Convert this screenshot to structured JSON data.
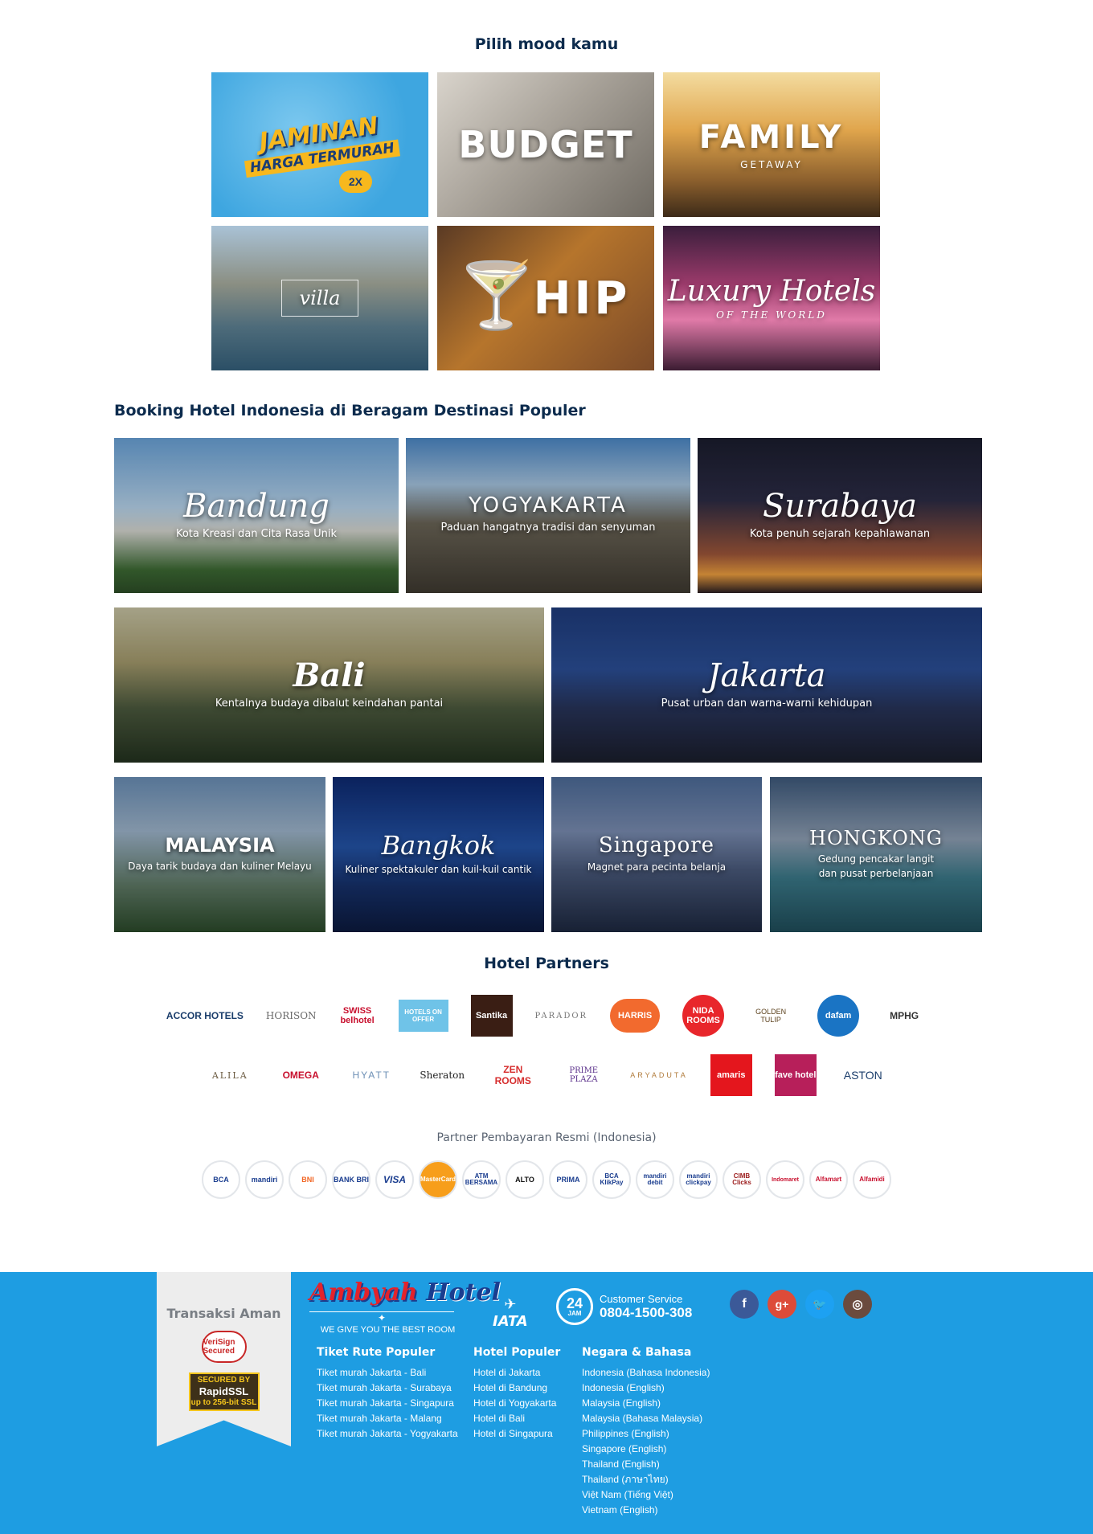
{
  "mood": {
    "title": "Pilih mood kamu",
    "cards": [
      {
        "label": "JAMINAN",
        "sub": "HARGA TERMURAH",
        "badge": "2X"
      },
      {
        "label": "BUDGET",
        "sub": ""
      },
      {
        "label": "FAMILY",
        "sub": "GETAWAY"
      },
      {
        "label": "villa",
        "sub": ""
      },
      {
        "label": "HIP",
        "sub": ""
      },
      {
        "label": "Luxury Hotels",
        "sub": "OF THE WORLD"
      }
    ]
  },
  "destinations": {
    "title": "Booking Hotel Indonesia di Beragam Destinasi Populer",
    "items": [
      {
        "name": "Bandung",
        "tagline": "Kota Kreasi dan Cita Rasa Unik"
      },
      {
        "name": "YOGYAKARTA",
        "tagline": "Paduan hangatnya tradisi dan senyuman"
      },
      {
        "name": "Surabaya",
        "tagline": "Kota penuh sejarah kepahlawanan"
      },
      {
        "name": "Bali",
        "tagline": "Kentalnya budaya dibalut keindahan pantai"
      },
      {
        "name": "Jakarta",
        "tagline": "Pusat urban dan warna-warni kehidupan"
      },
      {
        "name": "MALAYSIA",
        "tagline": "Daya tarik budaya dan kuliner Melayu"
      },
      {
        "name": "Bangkok",
        "tagline": "Kuliner spektakuler dan kuil-kuil cantik"
      },
      {
        "name": "Singapore",
        "tagline": "Magnet para pecinta belanja"
      },
      {
        "name": "HONGKONG",
        "tagline": "Gedung pencakar langit dan pusat perbelanjaan"
      }
    ]
  },
  "partners": {
    "title": "Hotel Partners",
    "row1": [
      "ACCOR HOTELS",
      "HORISON",
      "SWISS belhotel",
      "HOTELS ON OFFER",
      "Santika",
      "PARADOR",
      "HARRIS",
      "NIDA ROOMS",
      "GOLDEN TULIP",
      "dafam",
      "MPHG"
    ],
    "row2": [
      "ALILA",
      "OMEGA",
      "HYATT",
      "Sheraton",
      "ZEN ROOMS",
      "PRIME PLAZA",
      "ARYADUTA",
      "amaris",
      "fave hotel",
      "ASTON"
    ]
  },
  "payment": {
    "title": "Partner Pembayaran Resmi (Indonesia)",
    "items": [
      "BCA",
      "mandiri",
      "BNI",
      "BANK BRI",
      "VISA",
      "MasterCard",
      "ATM BERSAMA",
      "ALTO",
      "PRIMA",
      "BCA KlikPay",
      "mandiri debit",
      "mandiri clickpay",
      "CIMB Clicks",
      "Indomaret",
      "Alfamart",
      "Alfamidi"
    ]
  },
  "footer": {
    "secure_title": "Transaksi Aman",
    "verisign": "VeriSign Secured",
    "rapidssl_top": "SECURED BY",
    "rapidssl_name": "RapidSSL",
    "rapidssl_bottom": "up to 256-bit SSL",
    "brand_name": "Ambyah",
    "brand_hotel": "Hotel",
    "brand_tagline": "WE GIVE YOU THE BEST ROOM",
    "iata": "IATA",
    "cs_hours": "24",
    "cs_hours_unit": "JAM",
    "cs_label": "Customer Service",
    "cs_phone": "0804-1500-308",
    "col1_title": "Tiket Rute Populer",
    "col1_links": [
      "Tiket murah Jakarta - Bali",
      "Tiket murah Jakarta - Surabaya",
      "Tiket murah Jakarta - Singapura",
      "Tiket murah Jakarta - Malang",
      "Tiket murah Jakarta - Yogyakarta"
    ],
    "col2_title": "Hotel Populer",
    "col2_links": [
      "Hotel di Jakarta",
      "Hotel di Bandung",
      "Hotel di Yogyakarta",
      "Hotel di Bali",
      "Hotel di Singapura"
    ],
    "col3_title": "Negara & Bahasa",
    "col3_links": [
      "Indonesia (Bahasa Indonesia)",
      "Indonesia (English)",
      "Malaysia (English)",
      "Malaysia (Bahasa Malaysia)",
      "Philippines (English)",
      "Singapore (English)",
      "Thailand (English)",
      "Thailand (ภาษาไทย)",
      "Việt Nam (Tiếng Việt)",
      "Vietnam (English)"
    ]
  }
}
